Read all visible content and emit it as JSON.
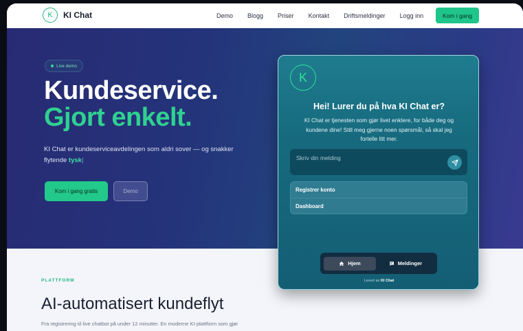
{
  "nav": {
    "brand": "KI Chat",
    "brand_mark": "K",
    "links": [
      "Demo",
      "Blogg",
      "Priser",
      "Kontakt",
      "Driftsmeldinger",
      "Logg inn"
    ],
    "cta": "Kom i gang"
  },
  "hero": {
    "badge": "Live demo",
    "title_line1": "Kundeservice.",
    "title_line2": "Gjort enkelt.",
    "lede_text": "KI Chat er kundeserviceavdelingen som aldri sover — og snakker flytende ",
    "lede_accent": "tysk",
    "lede_cursor": "|",
    "cta_primary": "Kom i gang gratis",
    "cta_secondary": "Demo"
  },
  "widget": {
    "logo_mark": "K",
    "title": "Hei! Lurer du på hva KI Chat er?",
    "description": "KI Chat er tjenesten som gjør livet enklere, for både deg og kundene dine! Still meg gjerne noen spørsmål, så skal jeg fortelle litt mer.",
    "input_placeholder": "Skriv din melding",
    "quick_links": [
      "Registrer konto",
      "Dashboard"
    ],
    "tabs": [
      {
        "label": "Hjem",
        "icon": "home-icon",
        "active": true
      },
      {
        "label": "Meldinger",
        "icon": "messages-icon",
        "active": false
      }
    ],
    "footer_prefix": "Levert av",
    "footer_brand": "KI Chat"
  },
  "platform": {
    "eyebrow": "PLATTFORM",
    "title": "AI-automatisert kundeflyt",
    "subtitle": "Fra registrering til live chatbot på under 12 minutter. En moderne KI-plattform som gjør"
  },
  "colors": {
    "accent_green": "#1fc58a",
    "hero_bg": "#24337a",
    "widget_bg": "#176a7e"
  }
}
